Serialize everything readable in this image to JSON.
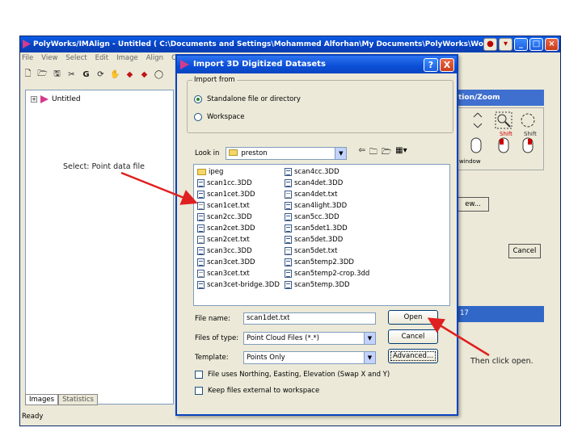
{
  "app": {
    "title": "PolyWorks/IMAlign - Untitled ( C:\\Documents and Settings\\Mohammed Alforhan\\My Documents\\PolyWorks\\Wor",
    "menu": [
      "File",
      "View",
      "Select",
      "Edit",
      "Image",
      "Align",
      "Conf"
    ],
    "tree_root": "Untitled",
    "bottom_tabs": [
      "Images",
      "Statistics"
    ],
    "status": "Ready",
    "right_panel": {
      "title": "tion/Zoom",
      "shift1": "Shift",
      "shift2": "Shift",
      "window_label": "window",
      "view_button": "ew...",
      "cancel_button": "Cancel",
      "list_item": "17"
    }
  },
  "dialog": {
    "title": "Import 3D Digitized Datasets",
    "help": "?",
    "close": "X",
    "import_from_label": "Import from",
    "radio_standalone": "Standalone file or directory",
    "radio_workspace": "Workspace",
    "look_in_label": "Look in",
    "look_in_value": "preston",
    "files_left": [
      "ipeg",
      "scan1cc.3DD",
      "scan1cet.3DD",
      "scan1cet.txt",
      "scan2cc.3DD",
      "scan2cet.3DD",
      "scan2cet.txt",
      "scan3cc.3DD",
      "scan3cet.3DD",
      "scan3cet.txt",
      "scan3cet-bridge.3DD"
    ],
    "files_right": [
      "scan4cc.3DD",
      "scan4det.3DD",
      "scan4det.txt",
      "scan4light.3DD",
      "scan5cc.3DD",
      "scan5det1.3DD",
      "scan5det.3DD",
      "scan5det.txt",
      "scan5temp2.3DD",
      "scan5temp2-crop.3dd",
      "scan5temp.3DD"
    ],
    "file_name_label": "File name:",
    "file_name_value": "scan1det.txt",
    "file_type_label": "Files of type:",
    "file_type_value": "Point Cloud Files (*.*)",
    "template_label": "Template:",
    "template_value": "Points Only",
    "open_button": "Open",
    "cancel_button": "Cancel",
    "advanced_button": "Advanced...",
    "check_northing": "File uses Northing, Easting, Elevation (Swap X and Y)",
    "check_external": "Keep files external to workspace"
  },
  "annotations": {
    "select_hint": "Select: Point data file",
    "open_hint": "Then click open."
  }
}
